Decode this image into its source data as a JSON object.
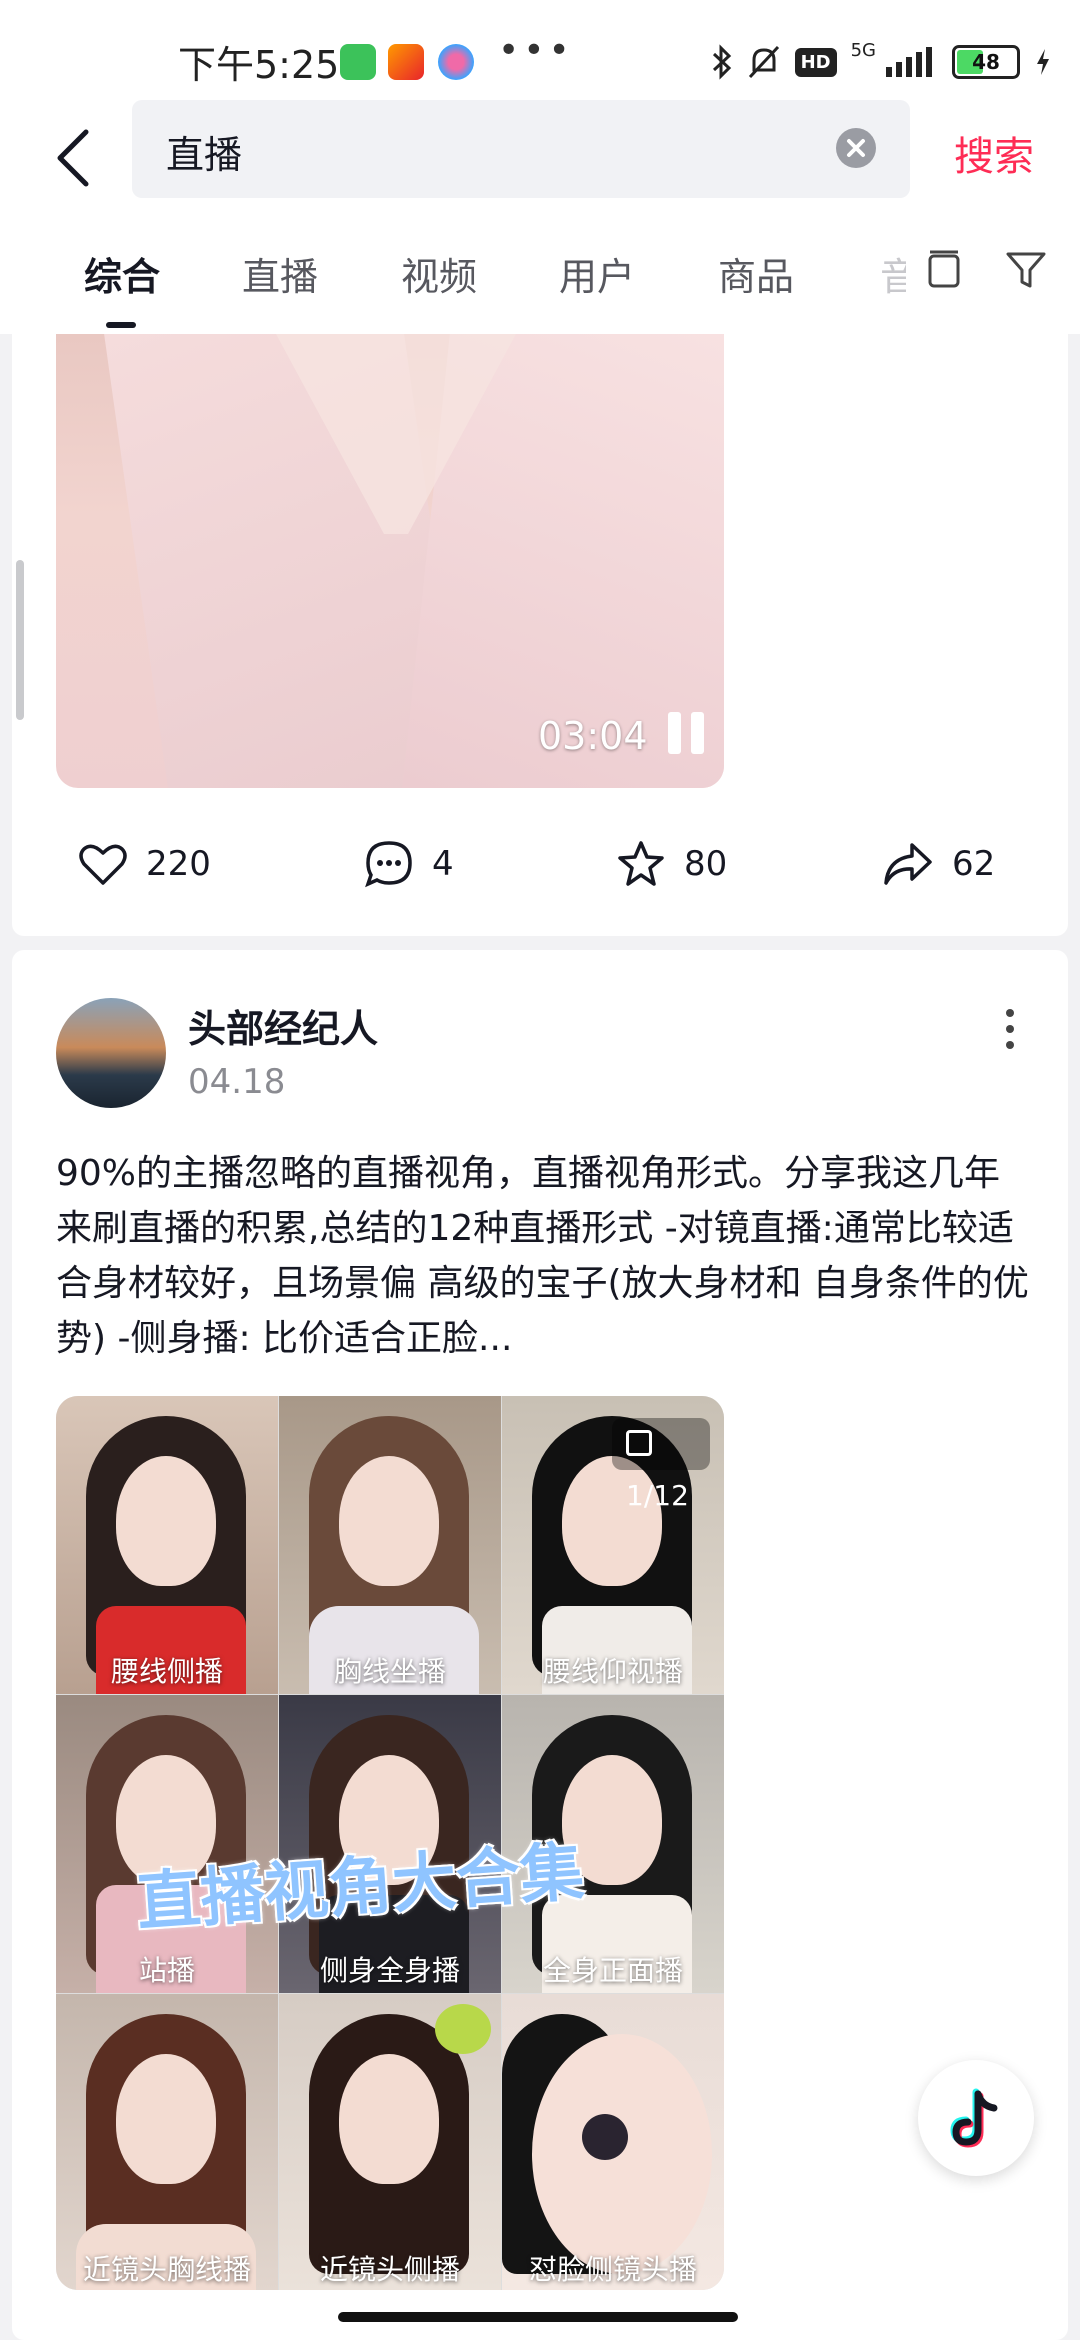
{
  "status_bar": {
    "time": "下午5:25",
    "network": "5G",
    "battery": "48",
    "battery_level": 0.48,
    "colors": {
      "battery": "#4cd964"
    }
  },
  "search": {
    "query": "直播",
    "search_label": "搜索",
    "accent_color": "#fe2c55"
  },
  "tabs": [
    {
      "label": "综合",
      "active": true
    },
    {
      "label": "直播"
    },
    {
      "label": "视频"
    },
    {
      "label": "用户"
    },
    {
      "label": "商品"
    },
    {
      "label": "音"
    }
  ],
  "video_card": {
    "duration": "03:04",
    "likes": "220",
    "comments": "4",
    "favorites": "80",
    "shares": "62"
  },
  "post": {
    "author": "头部经纪人",
    "date": "04.18",
    "text": "90%的主播忽略的直播视角，直播视角形式。分享我这几年来刷直播的积累,总结的12种直播形式 -对镜直播:通常比较适合身材较好，且场景偏 高级的宝子(放大身材和 自身条件的优势) -侧身播: 比价适合正脸...",
    "page_count": "1/12",
    "banner": "直播视角大合集",
    "grid_captions": [
      "腰线侧播",
      "胸线坐播",
      "腰线仰视播",
      "站播",
      "侧身全身播",
      "全身正面播",
      "近镜头胸线播",
      "近镜头侧播",
      "怼脸侧镜头播"
    ]
  }
}
